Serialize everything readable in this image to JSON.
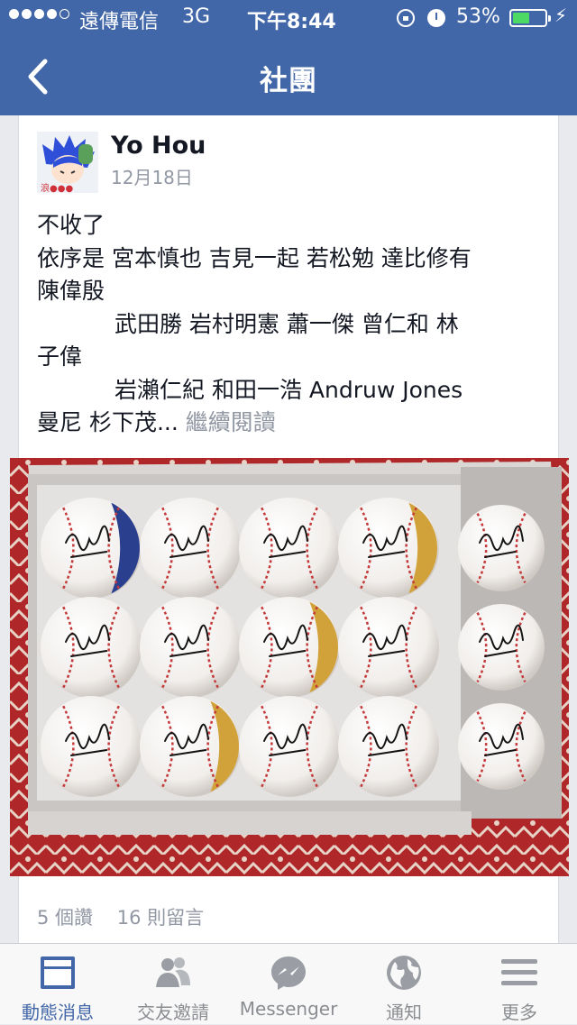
{
  "status_bar": {
    "carrier": "遠傳電信",
    "network": "3G",
    "time": "下午8:44",
    "battery_percent": "53%",
    "battery_level": 0.53
  },
  "nav": {
    "title": "社團"
  },
  "post": {
    "author": "Yo Hou",
    "date": "12月18日",
    "text_lines": [
      "不收了",
      "依序是 宮本慎也 吉見一起  若松勉  達比修有",
      "陳偉殷",
      "武田勝   岩村明憲  蕭一傑  曾仁和  林",
      "子偉",
      "岩瀨仁紀  和田一浩  Andruw Jones",
      "曼尼  杉下茂..."
    ],
    "continue_label": "繼續閱讀",
    "likes": "5 個讚",
    "comments": "16 則留言"
  },
  "tabs": [
    {
      "label": "動態消息",
      "icon": "news-feed-icon",
      "active": true
    },
    {
      "label": "交友邀請",
      "icon": "friend-requests-icon",
      "active": false
    },
    {
      "label": "Messenger",
      "icon": "messenger-icon",
      "active": false
    },
    {
      "label": "通知",
      "icon": "globe-icon",
      "active": false
    },
    {
      "label": "更多",
      "icon": "menu-icon",
      "active": false
    }
  ],
  "colors": {
    "brand": "#4267a8",
    "battery": "#4cd964",
    "muted_text": "#9197a3"
  }
}
